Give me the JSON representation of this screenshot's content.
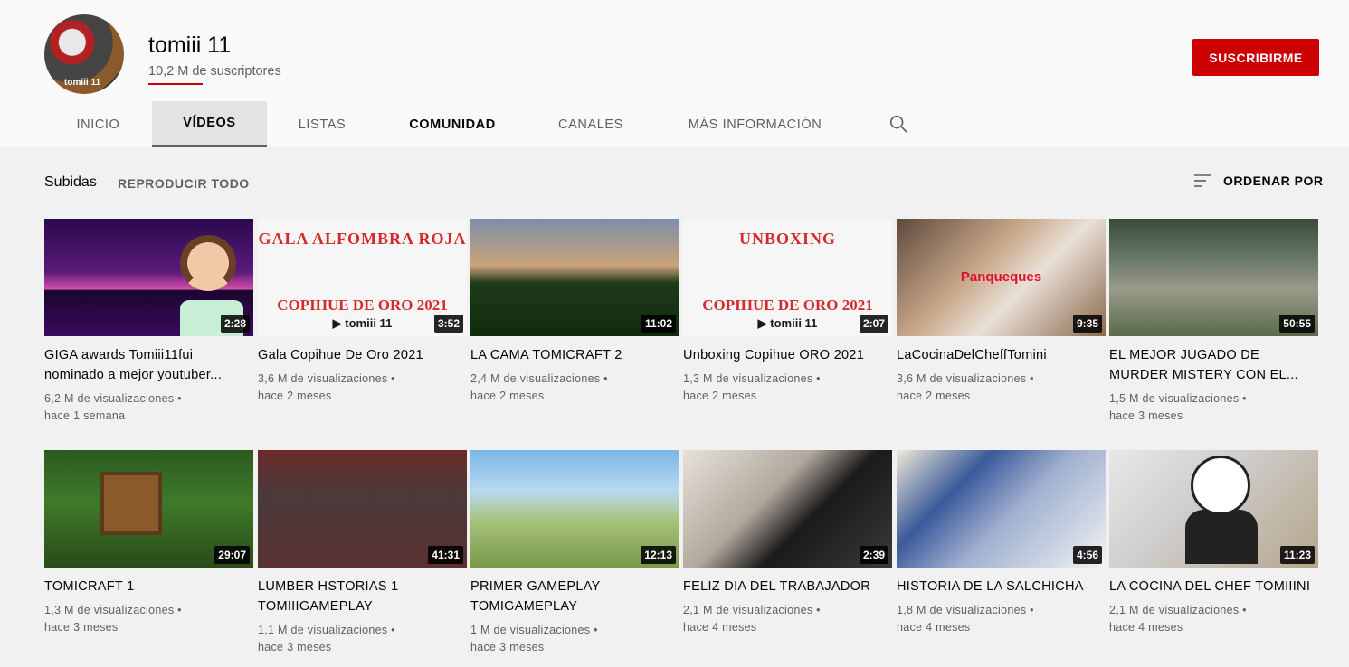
{
  "channel": {
    "name": "tomiii 11",
    "subscribers_num": "10,2 M",
    "subscribers_suffix": " de suscriptores",
    "avatar_text": "tomiii 11",
    "subscribe_label": "SUSCRIBIRME"
  },
  "tabs": [
    {
      "label": "INICIO"
    },
    {
      "label": "VÍDEOS"
    },
    {
      "label": "LISTAS"
    },
    {
      "label": "COMUNIDAD"
    },
    {
      "label": "CANALES"
    },
    {
      "label": "MÁS INFORMACIÓN"
    }
  ],
  "toolbar": {
    "section": "Subidas",
    "play_all": "REPRODUCIR TODO",
    "sort": "ORDENAR POR"
  },
  "videos": [
    {
      "title": "GIGA awards Tomiii11fui nominado a mejor youtuber...",
      "views": "6,2 M de visualizaciones",
      "age": "hace 1 semana",
      "duration": "2:28"
    },
    {
      "title": "Gala Copihue De Oro 2021",
      "views": "3,6 M de visualizaciones",
      "age": "hace 2 meses",
      "duration": "3:52",
      "thumb_top": "GALA ALFOMBRA ROJA",
      "thumb_bottom": "COPIHUE DE ORO 2021",
      "thumb_logo": "▶ tomiii 11"
    },
    {
      "title": "LA CAMA TOMICRAFT 2",
      "views": "2,4 M de visualizaciones",
      "age": "hace 2 meses",
      "duration": "11:02"
    },
    {
      "title": "Unboxing Copihue ORO 2021",
      "views": "1,3 M de visualizaciones",
      "age": "hace 2 meses",
      "duration": "2:07",
      "thumb_top": "UNBOXING",
      "thumb_bottom": "COPIHUE DE ORO 2021",
      "thumb_logo": "▶ tomiii 11"
    },
    {
      "title": "LaCocinaDelCheffTomini",
      "views": "3,6 M de visualizaciones",
      "age": "hace 2 meses",
      "duration": "9:35",
      "thumb_text": "Panqueques"
    },
    {
      "title": "EL MEJOR JUGADO DE MURDER MISTERY CON EL...",
      "views": "1,5 M de visualizaciones",
      "age": "hace 3 meses",
      "duration": "50:55"
    },
    {
      "title": "TOMICRAFT 1",
      "views": "1,3 M de visualizaciones",
      "age": "hace 3 meses",
      "duration": "29:07"
    },
    {
      "title": "LUMBER HSTORIAS 1 TOMIIIGAMEPLAY",
      "views": "1,1 M de visualizaciones",
      "age": "hace 3 meses",
      "duration": "41:31"
    },
    {
      "title": "PRIMER GAMEPLAY TOMIGAMEPLAY",
      "views": "1 M de visualizaciones",
      "age": "hace 3 meses",
      "duration": "12:13"
    },
    {
      "title": "FELIZ DIA DEL TRABAJADOR",
      "views": "2,1 M de visualizaciones",
      "age": "hace 4 meses",
      "duration": "2:39"
    },
    {
      "title": "HISTORIA DE LA SALCHICHA",
      "views": "1,8 M de visualizaciones",
      "age": "hace 4 meses",
      "duration": "4:56"
    },
    {
      "title": "LA COCINA DEL CHEF TOMIIINI",
      "views": "2,1 M de visualizaciones",
      "age": "hace 4 meses",
      "duration": "11:23"
    }
  ],
  "colors": {
    "accent": "#cc0000",
    "text": "#030303",
    "secondary": "#606060",
    "background": "#f1f1f1"
  },
  "icons": {
    "search": "search-icon",
    "sort": "sort-icon"
  }
}
